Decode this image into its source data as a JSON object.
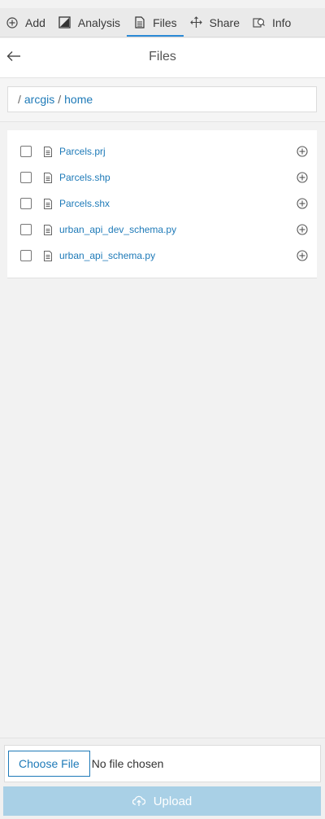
{
  "tabs": [
    {
      "label": "Add",
      "icon": "plus-circle-icon"
    },
    {
      "label": "Analysis",
      "icon": "analysis-icon"
    },
    {
      "label": "Files",
      "icon": "file-icon",
      "active": true
    },
    {
      "label": "Share",
      "icon": "share-icon"
    },
    {
      "label": "Info",
      "icon": "info-icon"
    }
  ],
  "header": {
    "title": "Files",
    "back_icon": "arrow-left-icon"
  },
  "breadcrumb": {
    "separator": "/",
    "items": [
      "arcgis",
      "home"
    ]
  },
  "files": [
    {
      "name": "Parcels.prj"
    },
    {
      "name": "Parcels.shp"
    },
    {
      "name": "Parcels.shx"
    },
    {
      "name": "urban_api_dev_schema.py"
    },
    {
      "name": "urban_api_schema.py"
    }
  ],
  "upload": {
    "choose_label": "Choose File",
    "no_file_text": "No file chosen",
    "upload_label": "Upload",
    "upload_icon": "upload-cloud-icon"
  },
  "colors": {
    "accent": "#2b8ad6",
    "link": "#1e7ab8",
    "upload_disabled": "#a9d0e6"
  }
}
